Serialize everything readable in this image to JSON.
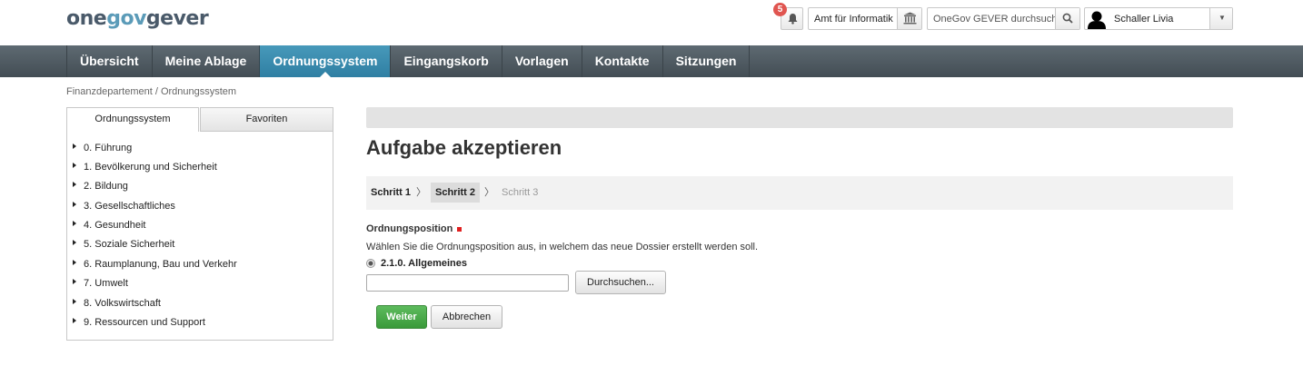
{
  "header": {
    "logo": {
      "part1": "one",
      "part2": "gov",
      "part3": "gever"
    },
    "notifications": {
      "count": "5",
      "icon": "bell-icon"
    },
    "org_unit": {
      "label": "Amt für Informatik",
      "icon": "building-icon"
    },
    "search": {
      "placeholder": "OneGov GEVER durchsuchen",
      "icon": "search-icon"
    },
    "user": {
      "name": "Schaller Livia",
      "icon": "avatar-silhouette"
    }
  },
  "nav": {
    "items": [
      "Übersicht",
      "Meine Ablage",
      "Ordnungssystem",
      "Eingangskorb",
      "Vorlagen",
      "Kontakte",
      "Sitzungen"
    ],
    "active": "Ordnungssystem"
  },
  "breadcrumb": "Finanzdepartement / Ordnungssystem",
  "sidebar": {
    "tabs": [
      "Ordnungssystem",
      "Favoriten"
    ],
    "tree": [
      "0. Führung",
      "1. Bevölkerung und Sicherheit",
      "2. Bildung",
      "3. Gesellschaftliches",
      "4. Gesundheit",
      "5. Soziale Sicherheit",
      "6. Raumplanung, Bau und Verkehr",
      "7. Umwelt",
      "8. Volkswirtschaft",
      "9. Ressourcen und Support"
    ]
  },
  "main": {
    "title": "Aufgabe akzeptieren",
    "steps": [
      "Schritt 1",
      "Schritt 2",
      "Schritt 3"
    ],
    "current_step": "Schritt 2",
    "field": {
      "label": "Ordnungsposition",
      "help": "Wählen Sie die Ordnungsposition aus, in welchem das neue Dossier erstellt werden soll.",
      "selected": "2.1.0. Allgemeines",
      "input_value": "",
      "browse_label": "Durchsuchen..."
    },
    "buttons": {
      "submit": "Weiter",
      "cancel": "Abbrechen"
    }
  },
  "colors": {
    "nav_active": "#3a8cb0",
    "nav_bg": "#4f5a61",
    "submit": "#4aaa4a",
    "badge": "#e05550",
    "required": "#e02020"
  }
}
